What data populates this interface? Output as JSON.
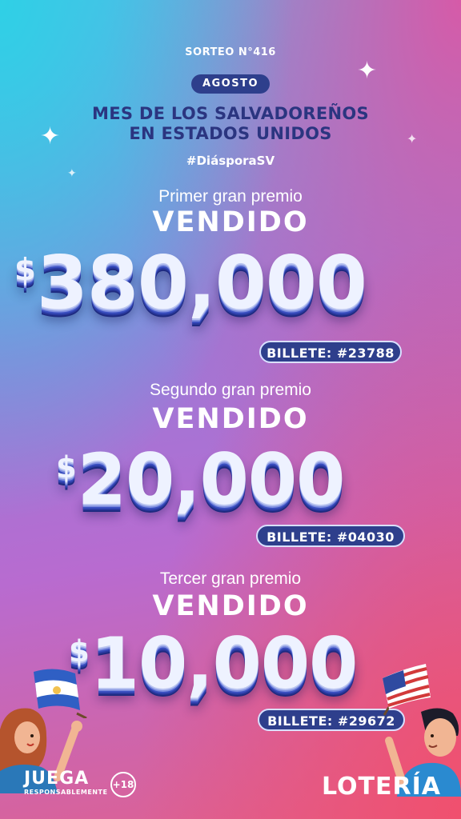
{
  "header": {
    "sorteo": "SORTEO N°416",
    "month_pill": "AGOSTO",
    "headline_line1": "MES DE LOS SALVADOREÑOS",
    "headline_line2": "EN ESTADOS UNIDOS",
    "hashtag": "#DiásporaSV"
  },
  "prizes": [
    {
      "label": "Primer gran premio",
      "status": "VENDIDO",
      "currency": "$",
      "amount": "380,000",
      "ticket": "BILLETE: #23788"
    },
    {
      "label": "Segundo gran premio",
      "status": "VENDIDO",
      "currency": "$",
      "amount": "20,000",
      "ticket": "BILLETE: #04030"
    },
    {
      "label": "Tercer gran premio",
      "status": "VENDIDO",
      "currency": "$",
      "amount": "10,000",
      "ticket": "BILLETE: #29672"
    }
  ],
  "footer": {
    "juega": "JUEGA",
    "responsablemente": "RESPONSABLEMENTE",
    "age_badge": "+18",
    "brand": "LOTERÍA"
  },
  "colors": {
    "pill_bg": "#2e3f8c",
    "headline": "#2b3580",
    "amount_face": "#eef2ff",
    "amount_shadow": "#2a3aa0"
  },
  "icons": [
    "sparkle-icon",
    "el-salvador-flag-icon",
    "usa-flag-icon",
    "woman-illustration",
    "man-illustration"
  ]
}
